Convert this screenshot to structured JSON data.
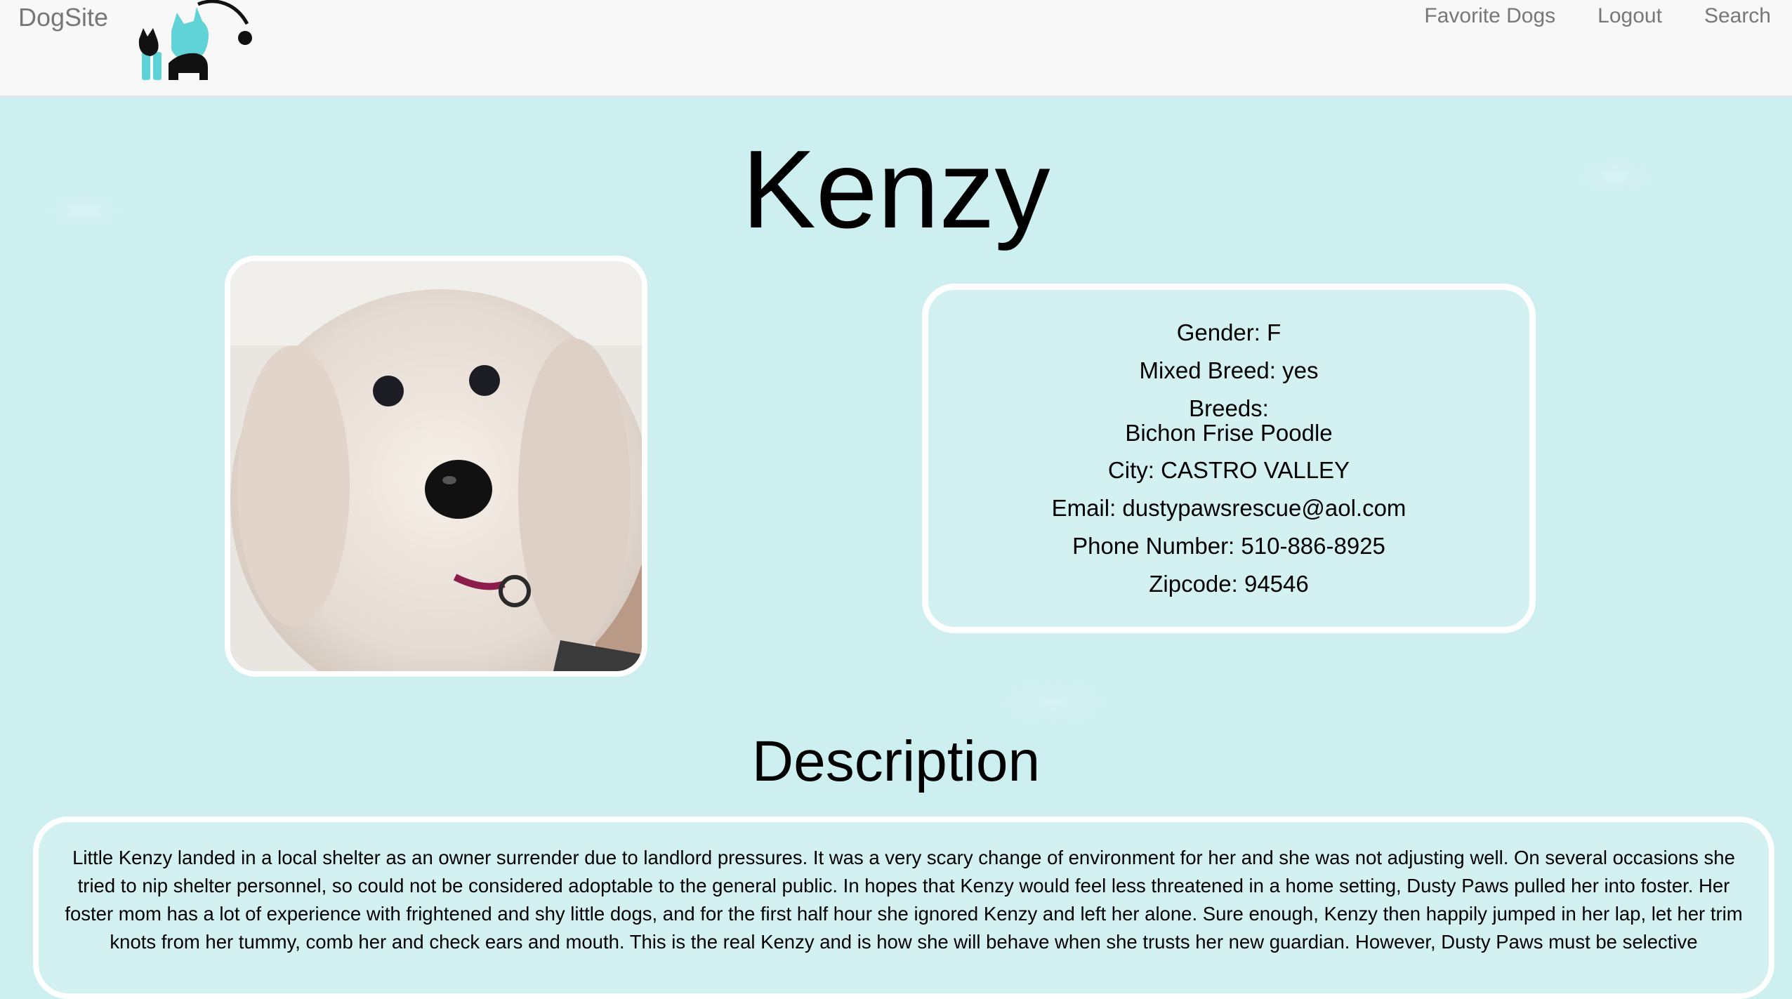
{
  "nav": {
    "brand": "DogSite",
    "links": [
      "Favorite Dogs",
      "Logout",
      "Search"
    ]
  },
  "dog": {
    "name": "Kenzy",
    "photo_icon": "dog-photo",
    "details": {
      "gender": "Gender: F",
      "mixed_breed": "Mixed Breed: yes",
      "breeds_label": "Breeds:",
      "breeds_value": "Bichon Frise Poodle",
      "city": "City: CASTRO VALLEY",
      "email": "Email: dustypawsrescue@aol.com",
      "phone": "Phone Number: 510-886-8925",
      "zipcode": "Zipcode: 94546"
    }
  },
  "description": {
    "heading": "Description",
    "text": "Little Kenzy landed in a local shelter as an owner surrender due to landlord pressures. It was a very scary change of environment for her and she was not adjusting well. On several occasions she tried to nip shelter personnel, so could not be considered adoptable to the general public. In hopes that Kenzy would feel less threatened in a home setting, Dusty Paws pulled her into foster. Her foster mom has a lot of experience with frightened and shy little dogs, and for the first half hour she ignored Kenzy and left her alone. Sure enough, Kenzy then happily jumped in her lap, let her trim knots from her tummy, comb her and check ears and mouth. This is the real Kenzy and is how she will behave when she trusts her new guardian. However, Dusty Paws must be selective"
  },
  "colors": {
    "background": "#cdeff0",
    "navbar": "#f8f8f8",
    "nav_text": "#777777",
    "logo_accent": "#5fd3d6"
  }
}
